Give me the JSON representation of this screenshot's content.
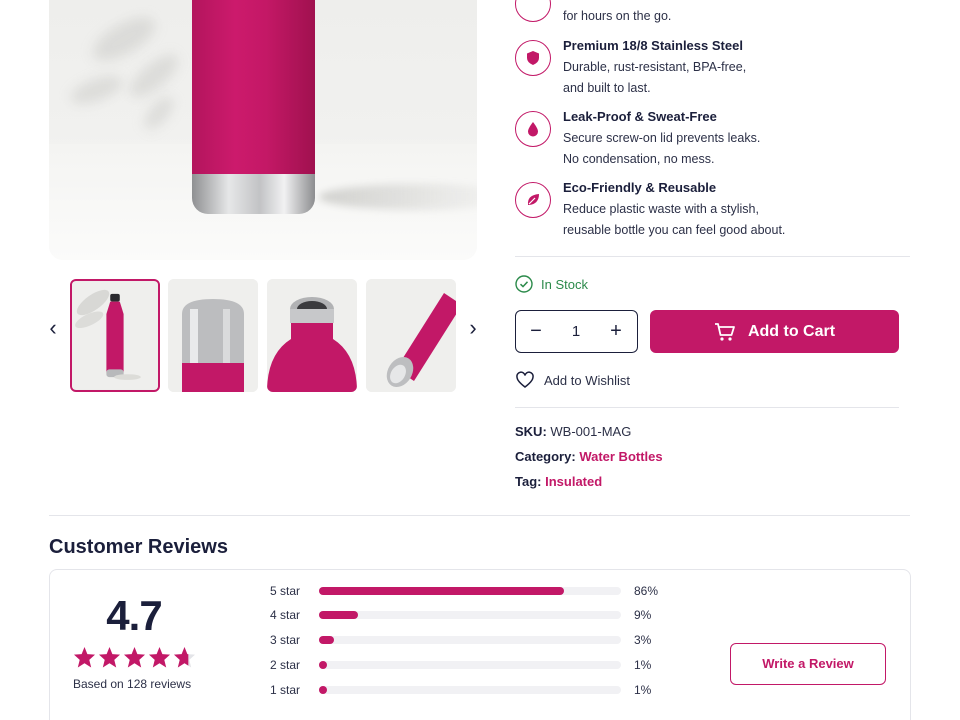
{
  "features": [
    {
      "icon": "partial-icon",
      "title": "",
      "desc_lines": [
        "",
        "for hours on the go."
      ]
    },
    {
      "icon": "shield-icon",
      "title": "Premium 18/8 Stainless Steel",
      "desc_lines": [
        "Durable, rust-resistant, BPA-free,",
        "and built to last."
      ]
    },
    {
      "icon": "droplet-icon",
      "title": "Leak-Proof & Sweat-Free",
      "desc_lines": [
        "Secure screw-on lid prevents leaks.",
        "No condensation, no mess."
      ]
    },
    {
      "icon": "leaf-icon",
      "title": "Eco-Friendly & Reusable",
      "desc_lines": [
        "Reduce plastic waste with a stylish,",
        "reusable bottle you can feel good about."
      ]
    }
  ],
  "stock": {
    "label": "In Stock",
    "color": "#2b8a4a"
  },
  "quantity": {
    "value": "1",
    "minus": "−",
    "plus": "+"
  },
  "add_to_cart": {
    "label": "Add to Cart"
  },
  "wishlist": {
    "label": "Add to Wishlist"
  },
  "meta": {
    "sku_key": "SKU:",
    "sku_value": "WB-001-MAG",
    "category_key": "Category:",
    "category_value": "Water Bottles",
    "tag_key": "Tag:",
    "tag_value": "Insulated"
  },
  "gallery": {
    "prev": "‹",
    "next": "›",
    "thumbnails": [
      "bottle-front",
      "bottle-cap-top",
      "bottle-open-top",
      "bottle-lying"
    ],
    "active_index": 0
  },
  "reviews": {
    "heading": "Customer Reviews",
    "average": "4.7",
    "stars_filled": 4.7,
    "based_on": "Based on 128 reviews",
    "breakdown": [
      {
        "label": "5 star",
        "percent": "86%",
        "fraction": 0.81
      },
      {
        "label": "4 star",
        "percent": "9%",
        "fraction": 0.13
      },
      {
        "label": "3 star",
        "percent": "3%",
        "fraction": 0.05
      },
      {
        "label": "2 star",
        "percent": "1%",
        "fraction": 0.025
      },
      {
        "label": "1 star",
        "percent": "1%",
        "fraction": 0.025
      }
    ],
    "write_label": "Write a Review"
  },
  "colors": {
    "accent": "#c21867",
    "text": "#1b1f3b",
    "stock_green": "#2b8a4a"
  }
}
